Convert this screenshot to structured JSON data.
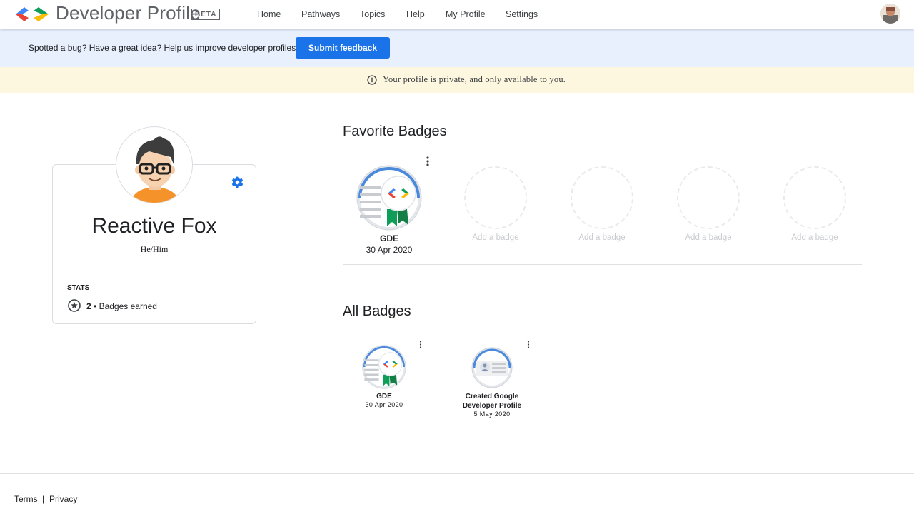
{
  "header": {
    "brand": "Developer Profile",
    "beta": "BETA",
    "nav": [
      "Home",
      "Pathways",
      "Topics",
      "Help",
      "My Profile",
      "Settings"
    ]
  },
  "feedback": {
    "text": "Spotted a bug? Have a great idea? Help us improve developer profiles!",
    "button": "Submit feedback"
  },
  "privacy": {
    "text": "Your profile is private, and only available to you."
  },
  "profile": {
    "name": "Reactive Fox",
    "pronouns": "He/Him",
    "stats_label": "STATS",
    "badges_count": "2",
    "badges_label": "Badges earned"
  },
  "favorite_badges": {
    "title": "Favorite Badges",
    "badge": {
      "name": "GDE",
      "date": "30 Apr 2020"
    },
    "empty_slots": [
      "Add a badge",
      "Add a badge",
      "Add a badge",
      "Add a badge"
    ]
  },
  "all_badges": {
    "title": "All Badges",
    "items": [
      {
        "name": "GDE",
        "date": "30 Apr 2020"
      },
      {
        "name_line1": "Created Google",
        "name_line2": "Developer Profile",
        "date": "5 May 2020"
      }
    ]
  },
  "footer": {
    "terms": "Terms",
    "separator": "|",
    "privacy": "Privacy"
  },
  "colors": {
    "accent": "#1a73e8",
    "feedback_bg": "#e8f0fe",
    "privacy_bg": "#fef7e0"
  },
  "icons": [
    "developers-logo-icon",
    "user-avatar",
    "info-icon",
    "gear-icon",
    "star-circle-icon",
    "more-vert-icon"
  ]
}
